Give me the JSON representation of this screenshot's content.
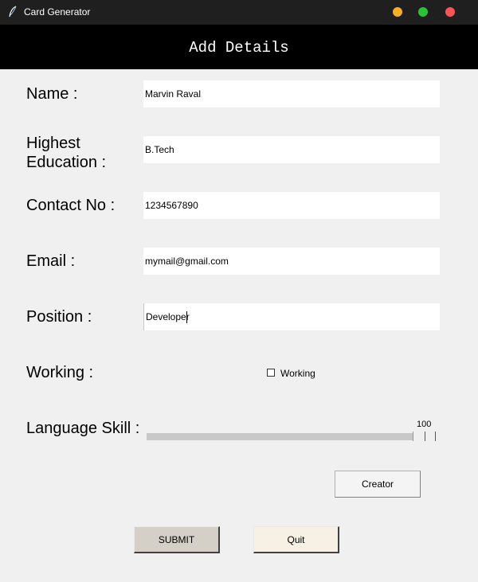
{
  "window": {
    "title": "Card Generator",
    "icon": "feather-icon"
  },
  "header": {
    "title": "Add Details"
  },
  "form": {
    "name": {
      "label": "Name :",
      "value": "Marvin Raval"
    },
    "education": {
      "label": "Highest\nEducation :",
      "value": "B.Tech"
    },
    "contact": {
      "label": "Contact No :",
      "value": "1234567890"
    },
    "email": {
      "label": "Email :",
      "value": "mymail@gmail.com"
    },
    "position": {
      "label": "Position :",
      "value": "Developer"
    },
    "working": {
      "label": "Working :",
      "checkbox_label": "Working",
      "checked": false
    },
    "language": {
      "label": "Language Skill :",
      "value": "100",
      "level": 100,
      "max": 100
    }
  },
  "buttons": {
    "creator": "Creator",
    "submit": "SUBMIT",
    "quit": "Quit"
  },
  "colors": {
    "minimize": "#f7ae27",
    "maximize": "#27c13a",
    "close": "#fd5357",
    "header_bg": "#000000",
    "background": "#f0f0f0"
  }
}
